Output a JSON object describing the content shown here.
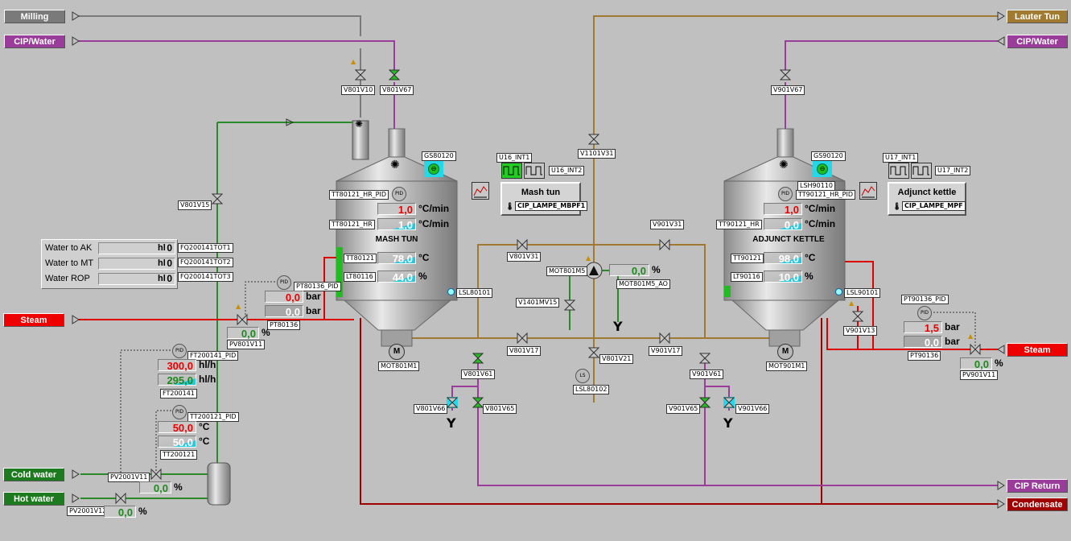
{
  "endpoints": {
    "milling": "Milling",
    "cip_water_left": "CIP/Water",
    "steam_left": "Steam",
    "cold_water": "Cold water",
    "hot_water": "Hot water",
    "lauter_tun": "Lauter Tun",
    "cip_water_right": "CIP/Water",
    "steam_right": "Steam",
    "cip_return": "CIP Return",
    "condensate": "Condensate"
  },
  "colors": {
    "cip": "#9a3d9a",
    "milling": "#7a7a7a",
    "lauter": "#a07a30",
    "steam": "#ee0000",
    "condensate": "#a00000",
    "water": "#1e7a1e",
    "pipe_purple": "#9a3d9a",
    "pipe_brown": "#a07a30",
    "pipe_green": "#2a8a2a",
    "pipe_red": "#dd0000"
  },
  "tags": {
    "v801v10": "V801V10",
    "v801v67": "V801V67",
    "v801v15": "V801V15",
    "gs80120": "GS80120",
    "tt80121_hr_pid": "TT80121_HR_PID",
    "tt80121_hr": "TT80121_HR",
    "tt80121": "TT80121",
    "lt80116": "LT80116",
    "lsl80101": "LSL80101",
    "pt80136_pid": "PT80136_PID",
    "pt80136": "PT80136",
    "pv801v11": "PV801V11",
    "mot801m1": "MOT801M1",
    "fq1": "FQ200141TOT1",
    "fq2": "FQ200141TOT2",
    "fq3": "FQ200141TOT3",
    "ft200141_pid": "FT200141_PID",
    "ft200141": "FT200141",
    "tt200121_pid": "TT200121_PID",
    "tt200121": "TT200121",
    "pv2001v11": "PV2001V11",
    "pv2001v12": "PV2001V12",
    "u16_int1": "U16_INT1",
    "u16_int2": "U16_INT2",
    "cip_lampe_mbpf1": "CIP_LAMPE_MBPF1",
    "v1101v31": "V1101V31",
    "v801v31": "V801V31",
    "v901v31": "V901V31",
    "mot801m5": "MOT801M5",
    "mot801m5_ao": "MOT801M5_AO",
    "v1401mv15": "V1401MV15",
    "v801v17": "V801V17",
    "v901v17": "V901V17",
    "v801v21": "V801V21",
    "lsl80102": "LSL80102",
    "v801v61": "V801V61",
    "v801v66": "V801V66",
    "v801v65": "V801V65",
    "v901v61": "V901V61",
    "v901v65": "V901V65",
    "v901v66": "V901V66",
    "v901v67": "V901V67",
    "gs90120": "GS90120",
    "u17_int1": "U17_INT1",
    "u17_int2": "U17_INT2",
    "lsh90110": "LSH90110",
    "tt90121_hr_pid": "TT90121_HR_PID",
    "tt90121_hr": "TT90121_HR",
    "tt90121": "TT90121",
    "lt90116": "LT90116",
    "lsl90101": "LSL90101",
    "v901v13": "V901V13",
    "pt90136_pid": "PT90136_PID",
    "pt90136": "PT90136",
    "pv901v11": "PV901V11",
    "mot901m1": "MOT901M1",
    "cip_lampe_mpf": "CIP_LAMPE_MPF"
  },
  "pid_label": "PID",
  "motor_label": "M",
  "ls_label": "LS",
  "mash_tun": {
    "title": "MASH TUN",
    "button": "Mash tun",
    "rate_sp": "1,0",
    "rate_pv": "1,0",
    "rate_unit": "°C/min",
    "temp": "78,0",
    "temp_unit": "°C",
    "level": "44,0",
    "level_unit": "%",
    "level_fraction": 0.44
  },
  "adjunct_kettle": {
    "title": "ADJUNCT KETTLE",
    "button": "Adjunct kettle",
    "rate_sp": "1,0",
    "rate_pv": "0,0",
    "rate_unit": "°C/min",
    "temp": "98,0",
    "temp_unit": "°C",
    "level": "10,0",
    "level_unit": "%",
    "level_fraction": 0.1
  },
  "water_totals": {
    "rows": [
      {
        "label": "Water to AK",
        "value": "0",
        "unit": "hl"
      },
      {
        "label": "Water to MT",
        "value": "0",
        "unit": "hl"
      },
      {
        "label": "Water ROP",
        "value": "0",
        "unit": "hl"
      }
    ]
  },
  "steam_mt": {
    "sp": "0,0",
    "pv": "0,0",
    "unit": "bar",
    "valve": "0,0",
    "valve_unit": "%"
  },
  "flow": {
    "sp": "300,0",
    "pv": "295,0",
    "unit": "hl/h"
  },
  "water_temp": {
    "sp": "50,0",
    "pv": "50,0",
    "unit": "°C"
  },
  "pv2001v11_value": "0,0",
  "pv2001v12_value": "0,0",
  "pct_unit": "%",
  "pump": {
    "value": "0,0",
    "unit": "%"
  },
  "steam_ak": {
    "sp": "1,5",
    "pv": "0,0",
    "unit": "bar",
    "valve": "0,0",
    "valve_unit": "%"
  }
}
